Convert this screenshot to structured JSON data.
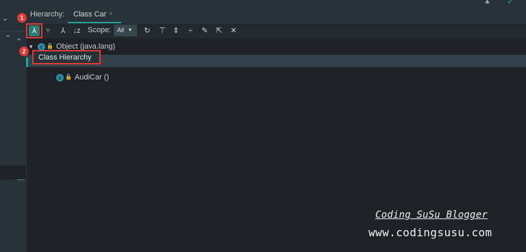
{
  "hierarchy_panel": {
    "title_label": "Hierarchy:",
    "tab": {
      "label": "Class Car",
      "close": "×"
    },
    "toolbar": {
      "scope_label": "Scope:",
      "scope_value": "All",
      "scope_arrow": "▾",
      "buttons": [
        {
          "icon": "class-hierarchy-icon",
          "glyph": "⅄"
        },
        {
          "icon": "supertypes-icon",
          "glyph": "⑂"
        },
        {
          "icon": "subtypes-icon",
          "glyph": "⅄"
        },
        {
          "icon": "sort-alpha-icon",
          "glyph": "↓z"
        },
        {
          "icon": "refresh-icon",
          "glyph": "↻"
        },
        {
          "icon": "filter-icon",
          "glyph": "⊤"
        },
        {
          "icon": "expand-all-icon",
          "glyph": "⇕"
        },
        {
          "icon": "collapse-all-icon",
          "glyph": "÷"
        },
        {
          "icon": "pin-icon",
          "glyph": "✎"
        },
        {
          "icon": "open-in-window-icon",
          "glyph": "⇱"
        },
        {
          "icon": "close-icon",
          "glyph": "✕"
        }
      ]
    },
    "tree": {
      "root": {
        "label": "Object (java.lang)",
        "badge": "c",
        "expand": "▾"
      },
      "child": {
        "label": "AudiCar ()",
        "badge": "c"
      }
    },
    "tooltip": "Class Hierarchy"
  },
  "callouts": {
    "one": "1",
    "two": "2"
  },
  "gutter": {
    "chev_down": "⌄",
    "chev_up": "⌃"
  },
  "watermark": {
    "line1": "Coding SuSu   Blogger",
    "line2": "www.codingsusu.com"
  },
  "colors": {
    "accent": "#26a69a",
    "callout": "#e53935",
    "background": "#1e2226"
  }
}
